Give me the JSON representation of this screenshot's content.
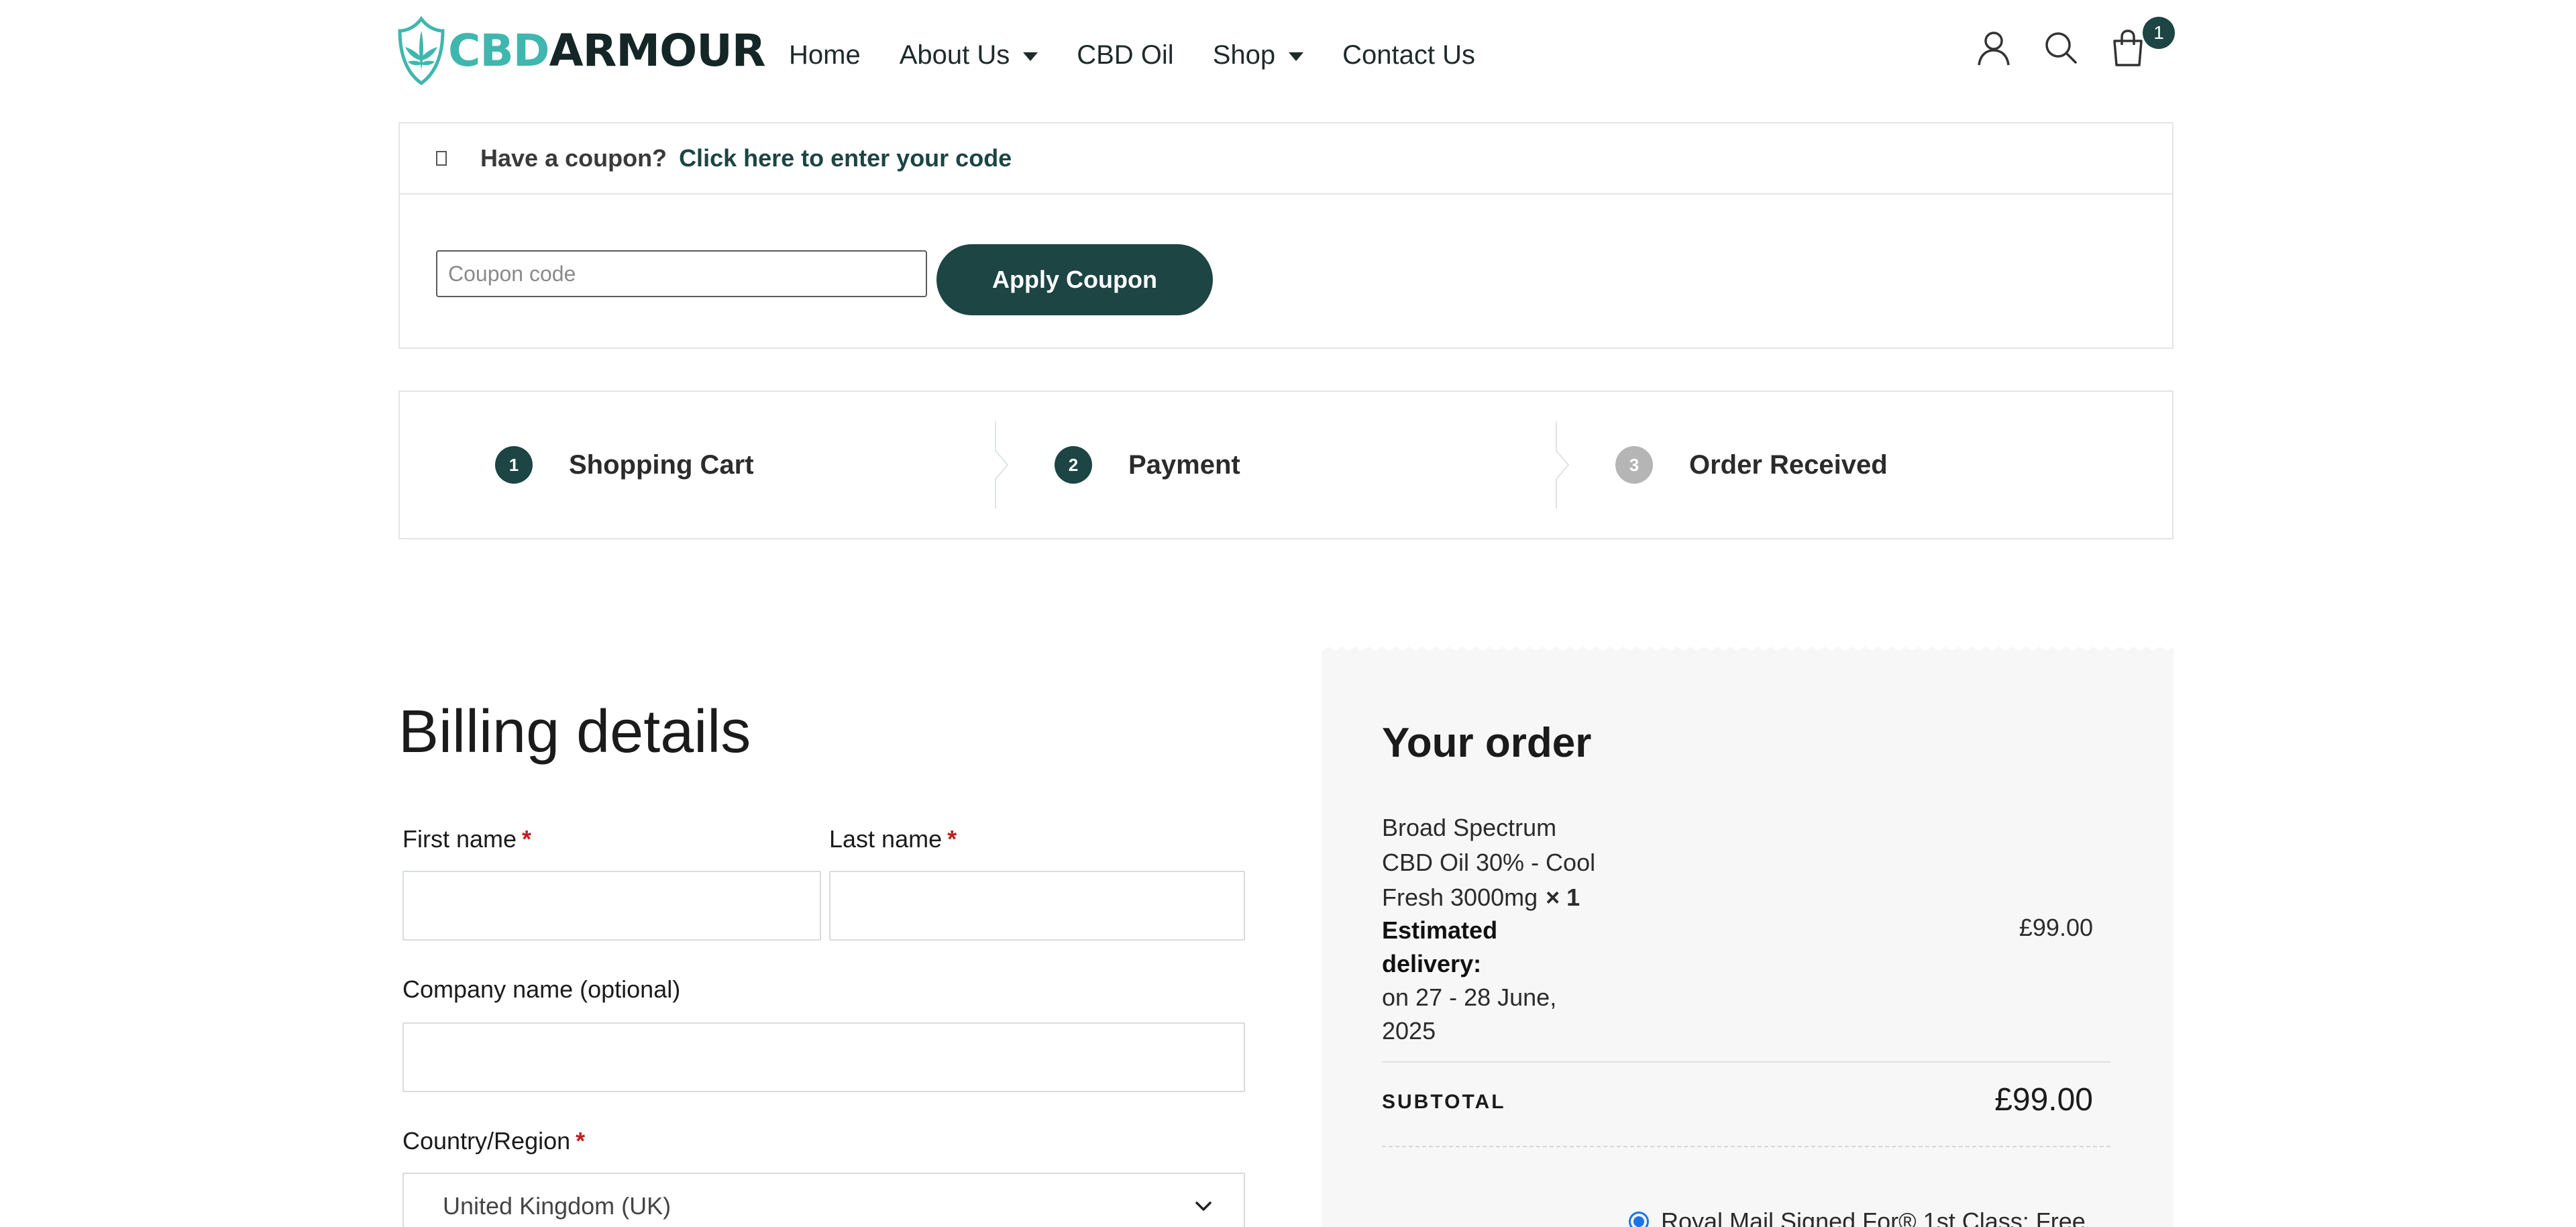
{
  "header": {
    "logo": {
      "part1": "CBD",
      "part2": "ARMOUR"
    },
    "nav": [
      {
        "label": "Home",
        "dropdown": false
      },
      {
        "label": "About Us",
        "dropdown": true
      },
      {
        "label": "CBD Oil",
        "dropdown": false
      },
      {
        "label": "Shop",
        "dropdown": true
      },
      {
        "label": "Contact Us",
        "dropdown": false
      }
    ],
    "icons": [
      "user-icon",
      "search-icon",
      "cart-icon"
    ],
    "cart_count": "1"
  },
  "coupon": {
    "question": "Have a coupon?",
    "link": "Click here to enter your code",
    "placeholder": "Coupon code",
    "button": "Apply Coupon"
  },
  "steps": [
    {
      "num": "1",
      "label": "Shopping Cart",
      "active": true
    },
    {
      "num": "2",
      "label": "Payment",
      "active": true
    },
    {
      "num": "3",
      "label": "Order Received",
      "active": false
    }
  ],
  "billing": {
    "title": "Billing details",
    "first_name": "First name",
    "last_name": "Last name",
    "company": "Company name (optional)",
    "country_label": "Country/Region",
    "country_value": "United Kingdom (UK)",
    "required_mark": "*"
  },
  "order": {
    "title": "Your order",
    "product_name": "Broad Spectrum CBD Oil 30% - Cool Fresh 3000mg",
    "qty": "× 1",
    "estimated_label": "Estimated delivery:",
    "estimated_date": "on 27 - 28 June, 2025",
    "line_price": "£99.00",
    "subtotal_label": "SUBTOTAL",
    "subtotal_value": "£99.00",
    "shipping_option": "Royal Mail Signed For® 1st Class: Free"
  },
  "colors": {
    "brand_dark": "#1c4544",
    "brand_teal": "#3fb7ae",
    "required": "#c21d1d",
    "panel_bg": "#f7f7f7"
  }
}
